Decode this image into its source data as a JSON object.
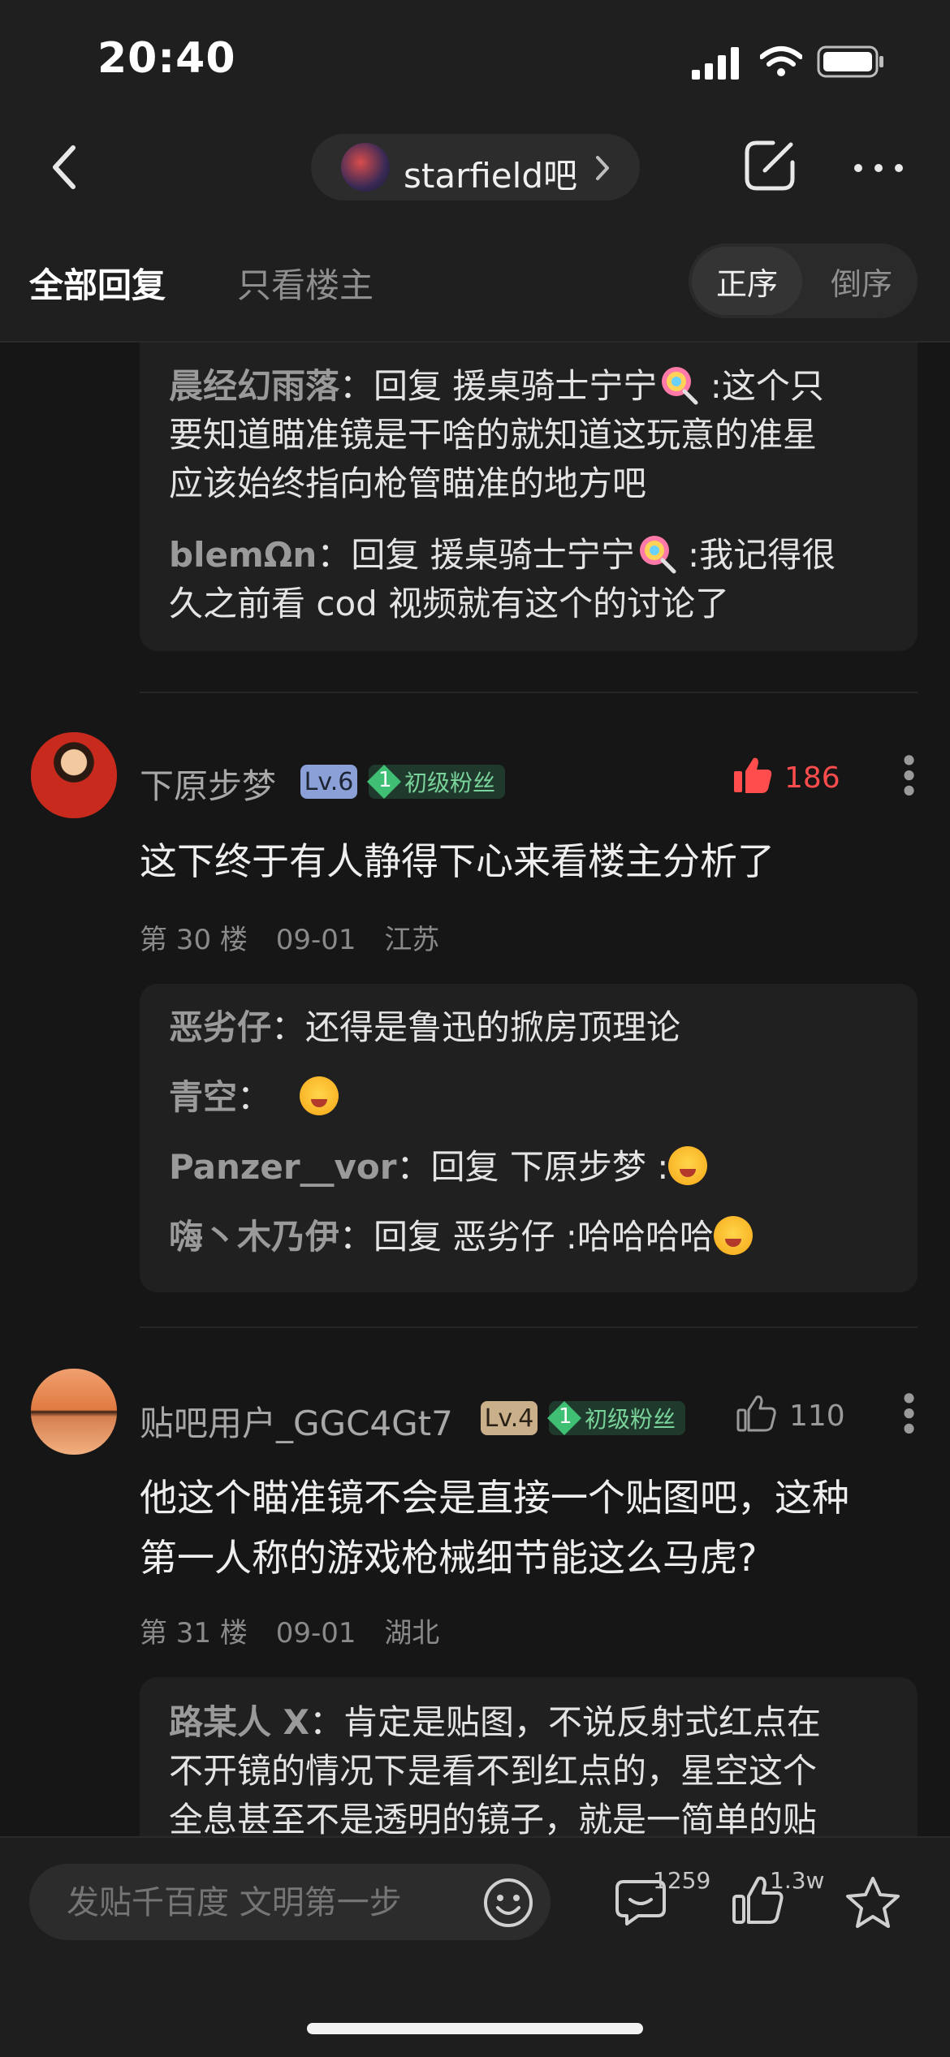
{
  "status_bar": {
    "time": "20:40"
  },
  "nav": {
    "forum_name": "starfield吧"
  },
  "tabs": {
    "all": "全部回复",
    "owner_only": "只看楼主",
    "asc": "正序",
    "desc": "倒序"
  },
  "top_replies": [
    {
      "name": "晨经幻雨落",
      "sep": "：",
      "line1": "回复 援桌骑士宁宁",
      "line1_end": " :这个只",
      "line2": "要知道瞄准镜是干啥的就知道这玩意的准星",
      "line3": "应该始终指向枪管瞄准的地方吧"
    },
    {
      "name": "blemΩn",
      "sep": "：",
      "line1": "回复 援桌骑士宁宁",
      "line1_end": " :我记得很",
      "line2": "久之前看 cod 视频就有这个的讨论了"
    }
  ],
  "posts": [
    {
      "username": "下原步梦",
      "level": "Lv.6",
      "fan_level": "1",
      "fan_label": "初级粉丝",
      "likes": "186",
      "content": "这下终于有人静得下心来看楼主分析了",
      "floor": "第 30 楼",
      "date": "09-01",
      "location": "江苏",
      "replies": [
        {
          "name": "恶劣仔",
          "text": "：还得是鲁迅的掀房顶理论"
        },
        {
          "name": "青空",
          "text": "： "
        },
        {
          "name": "Panzer__vor",
          "text": "：回复 下原步梦 :"
        },
        {
          "name": "嗨丶木乃伊",
          "text": "：回复 恶劣仔 :哈哈哈哈"
        }
      ]
    },
    {
      "username": "贴吧用户_GGC4Gt7",
      "level": "Lv.4",
      "fan_level": "1",
      "fan_label": "初级粉丝",
      "likes": "110",
      "content_line1": "他这个瞄准镜不会是直接一个贴图吧，这种",
      "content_line2": "第一人称的游戏枪械细节能这么马虎?",
      "floor": "第 31 楼",
      "date": "09-01",
      "location": "湖北",
      "reply": {
        "name": "路某人 X",
        "line1": "：肯定是贴图，不说反射式红点在",
        "line2": "不开镜的情况下是看不到红点的，星空这个",
        "line3": "全息甚至不是透明的镜子，就是一简单的贴"
      }
    }
  ],
  "bottom": {
    "placeholder": "发贴千百度 文明第一步",
    "comments": "1259",
    "likes": "1.3w"
  },
  "colors": {
    "like_active": "#ff4d4d",
    "fan_badge": "#79d39a",
    "lv6": "#8aa0d6",
    "lv4": "#c9b08a"
  }
}
